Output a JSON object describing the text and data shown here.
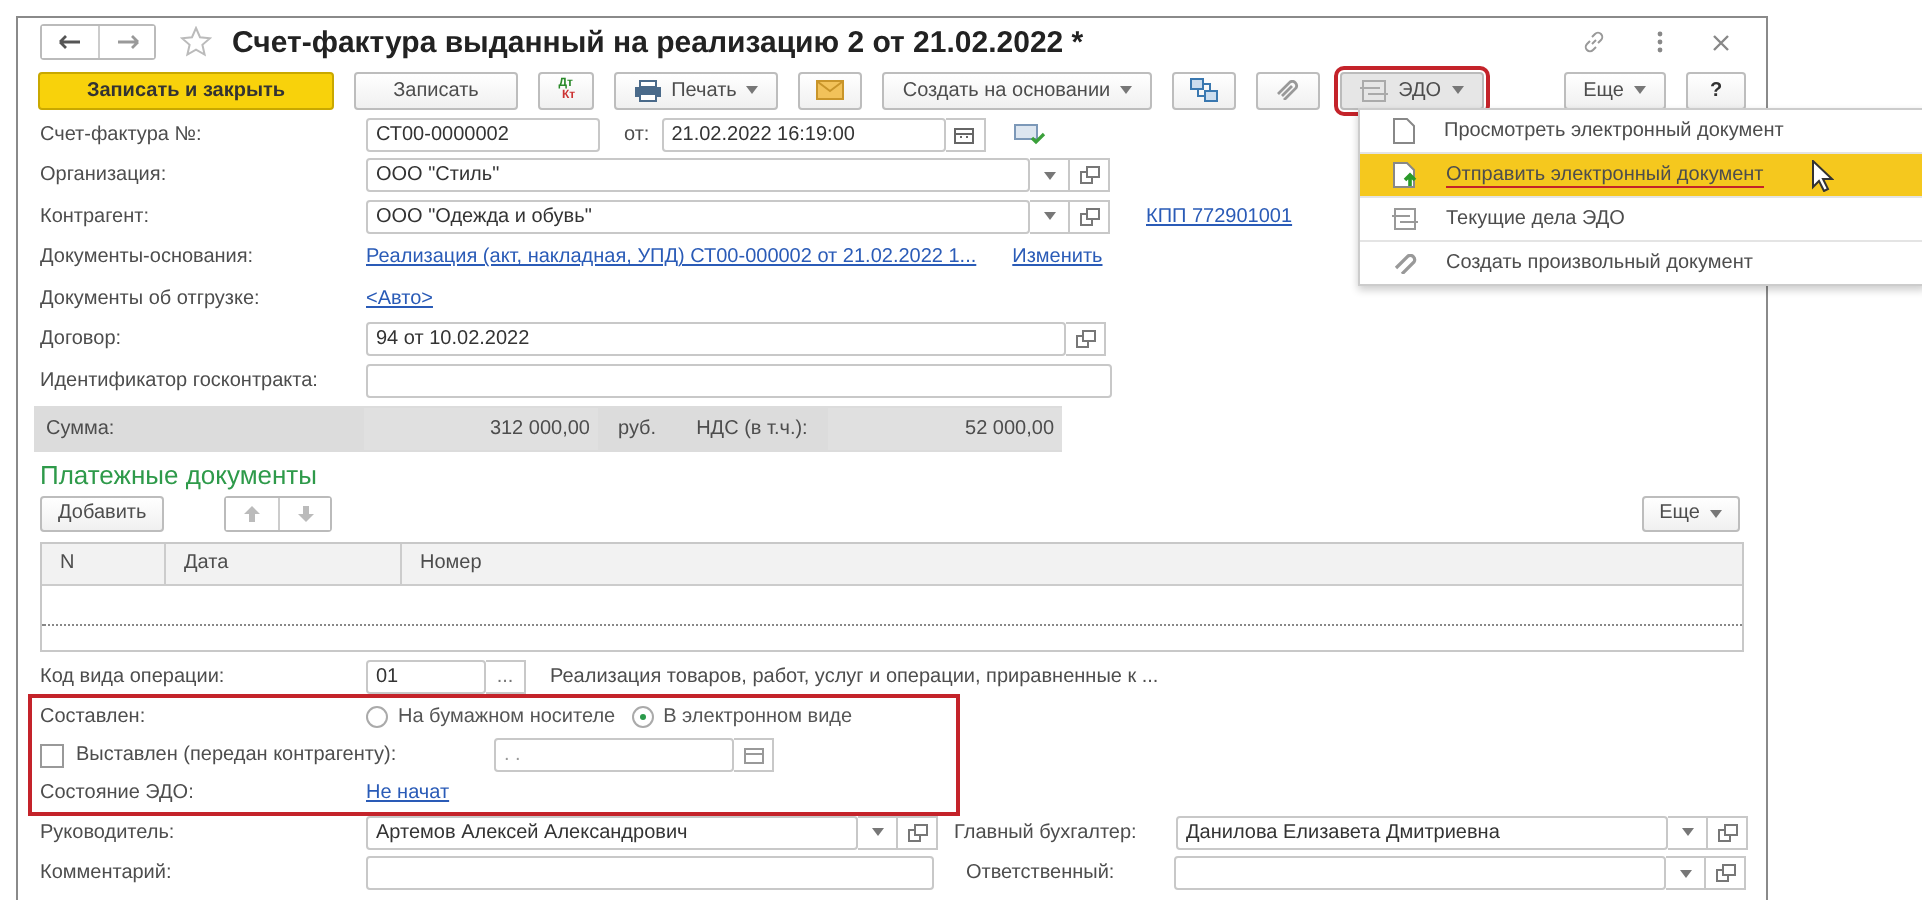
{
  "window": {
    "title": "Счет-фактура выданный на реализацию 2 от 21.02.2022 *"
  },
  "toolbar": {
    "save_close": "Записать и закрыть",
    "save": "Записать",
    "dtkt": {
      "top": "Дт",
      "bottom": "Кт"
    },
    "print": "Печать",
    "create_based_on": "Создать на основании",
    "edo": {
      "label": "ЭДО",
      "highlighted": true,
      "expanded": true
    },
    "more": "Еще",
    "help": "?"
  },
  "edo_menu": [
    {
      "label": "Просмотреть электронный документ",
      "selected": false
    },
    {
      "label": "Отправить электронный документ",
      "selected": true
    },
    {
      "label": "Текущие дела ЭДО",
      "selected": false
    },
    {
      "label": "Создать произвольный документ",
      "selected": false
    }
  ],
  "invoice": {
    "label": "Счет-фактура №:",
    "number": "СТ00-0000002",
    "date_label": "от:",
    "date": "21.02.2022 16:19:00"
  },
  "fields": [
    {
      "kind": "select",
      "label": "Организация:",
      "value": "ООО \"Стиль\""
    },
    {
      "kind": "select",
      "label": "Контрагент:",
      "value": "ООО \"Одежда и обувь\"",
      "link": "КПП 772901001"
    },
    {
      "kind": "link",
      "label": "Документы-основания:",
      "value": "Реализация (акт, накладная, УПД) СТ00-000002 от 21.02.2022 1...",
      "link": "Изменить"
    },
    {
      "kind": "link",
      "label": "Документы об отгрузке:",
      "value": "<Авто>"
    },
    {
      "kind": "ref",
      "label": "Договор:",
      "value": "94 от 10.02.2022"
    },
    {
      "kind": "text",
      "label": "Идентификатор госконтракта:"
    }
  ],
  "totals": {
    "label": "Сумма:",
    "amount": "312 000,00",
    "currency": "руб.",
    "vat_label": "НДС (в т.ч.):",
    "vat": "52 000,00"
  },
  "payments": {
    "title": "Платежные документы",
    "add": "Добавить",
    "more": "Еще",
    "columns": [
      "N",
      "Дата",
      "Номер"
    ]
  },
  "operation": {
    "label": "Код вида операции:",
    "code": "01",
    "code_button": "...",
    "description": "Реализация товаров, работ, услуг и операции, приравненные к ..."
  },
  "edo_section": {
    "highlighted": true,
    "composed_label": "Составлен:",
    "options": [
      {
        "label": "На бумажном носителе",
        "selected": false
      },
      {
        "label": "В электронном виде",
        "selected": true
      }
    ],
    "issued": {
      "label": "Выставлен (передан контрагенту):",
      "checked": false,
      "date": ". ."
    },
    "status_label": "Состояние ЭДО:",
    "status": "Не начат"
  },
  "signers": [
    {
      "label": "Руководитель:",
      "value": "Артемов Алексей Александрович"
    },
    {
      "label": "Главный бухгалтер:",
      "value": "Данилова Елизавета Дмитриевна"
    }
  ],
  "comment": {
    "label": "Комментарий:"
  },
  "responsible": {
    "label": "Ответственный:"
  }
}
